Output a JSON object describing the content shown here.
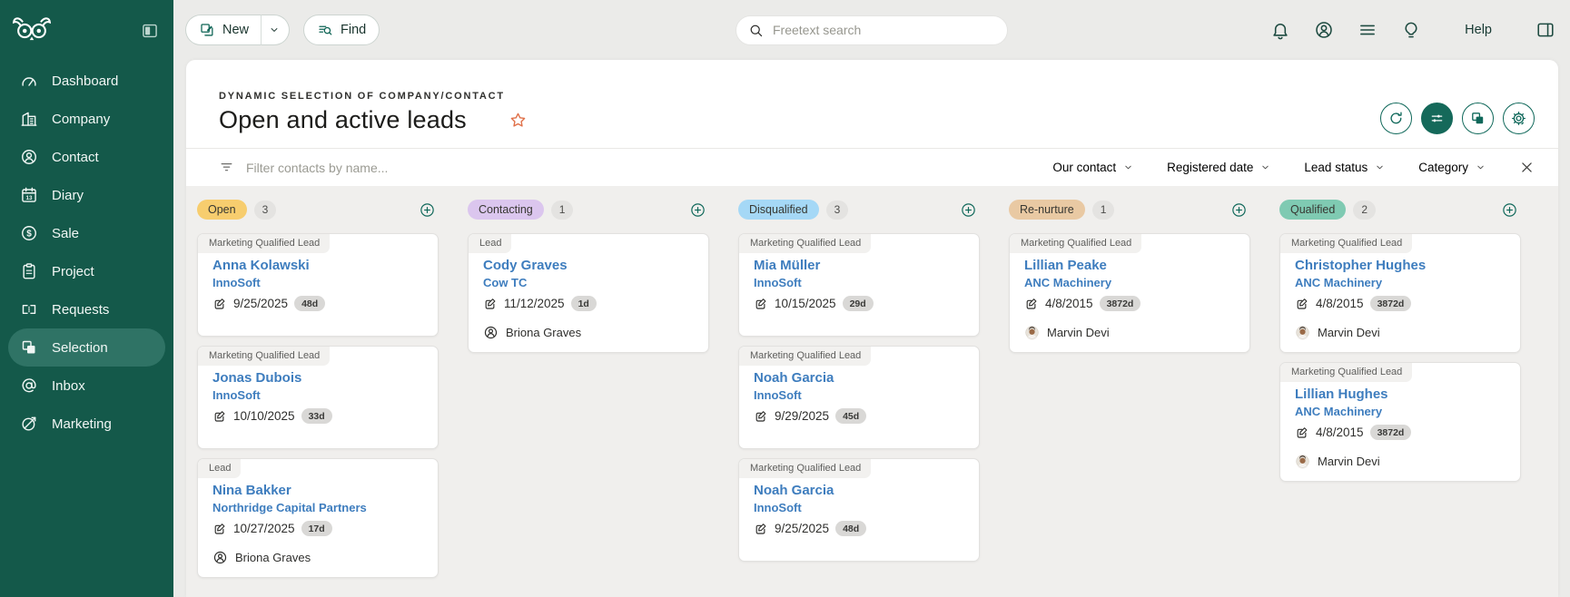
{
  "theme": {
    "sidebar_bg": "#14594a",
    "accent_teal": "#0f685a",
    "link_blue": "#3e7dbe",
    "star_orange": "#e0714a",
    "board_bg": "#f0efed"
  },
  "sidebar": {
    "items": [
      {
        "label": "Dashboard",
        "icon": "dashboard-icon",
        "active": false
      },
      {
        "label": "Company",
        "icon": "company-icon",
        "active": false
      },
      {
        "label": "Contact",
        "icon": "contact-icon",
        "active": false
      },
      {
        "label": "Diary",
        "icon": "diary-icon",
        "active": false
      },
      {
        "label": "Sale",
        "icon": "sale-icon",
        "active": false
      },
      {
        "label": "Project",
        "icon": "project-icon",
        "active": false
      },
      {
        "label": "Requests",
        "icon": "requests-icon",
        "active": false
      },
      {
        "label": "Selection",
        "icon": "selection-icon",
        "active": true
      },
      {
        "label": "Inbox",
        "icon": "inbox-icon",
        "active": false
      },
      {
        "label": "Marketing",
        "icon": "marketing-icon",
        "active": false
      }
    ]
  },
  "topbar": {
    "new_label": "New",
    "find_label": "Find",
    "search_placeholder": "Freetext search",
    "help_label": "Help",
    "icons": [
      {
        "icon": "bell-icon",
        "name": "notifications-button"
      },
      {
        "icon": "account-icon",
        "name": "account-button"
      },
      {
        "icon": "menu-icon",
        "name": "menu-button"
      },
      {
        "icon": "lightbulb-icon",
        "name": "tips-button"
      }
    ]
  },
  "header": {
    "eyebrow": "DYNAMIC SELECTION OF COMPANY/CONTACT",
    "title": "Open and active leads",
    "actions": [
      {
        "icon": "refresh-icon",
        "filled": false,
        "name": "refresh-button"
      },
      {
        "icon": "sliders-icon",
        "filled": true,
        "name": "display-settings-button"
      },
      {
        "icon": "copy-squares-icon",
        "filled": false,
        "name": "selection-mode-button"
      },
      {
        "icon": "gear-icon",
        "filled": false,
        "name": "settings-button"
      }
    ]
  },
  "filter": {
    "placeholder": "Filter contacts by name...",
    "dropdowns": [
      "Our contact",
      "Registered date",
      "Lead status",
      "Category"
    ]
  },
  "board": {
    "columns": [
      {
        "name": "Open",
        "count": "3",
        "color": "#f7cd6e",
        "cards": [
          {
            "tag": "Marketing Qualified Lead",
            "name": "Anna Kolawski",
            "company": "InnoSoft",
            "date": "9/25/2025",
            "age": "48d"
          },
          {
            "tag": "Marketing Qualified Lead",
            "name": "Jonas Dubois",
            "company": "InnoSoft",
            "date": "10/10/2025",
            "age": "33d"
          },
          {
            "tag": "Lead",
            "name": "Nina Bakker",
            "company": "Northridge Capital Partners",
            "date": "10/27/2025",
            "age": "17d",
            "owner": "Briona Graves",
            "owner_type": "icon"
          }
        ]
      },
      {
        "name": "Contacting",
        "count": "1",
        "color": "#dbc6ee",
        "cards": [
          {
            "tag": "Lead",
            "name": "Cody Graves",
            "company": "Cow TC",
            "date": "11/12/2025",
            "age": "1d",
            "owner": "Briona Graves",
            "owner_type": "icon"
          }
        ]
      },
      {
        "name": "Disqualified",
        "count": "3",
        "color": "#a5d8f6",
        "cards": [
          {
            "tag": "Marketing Qualified Lead",
            "name": "Mia Müller",
            "company": "InnoSoft",
            "date": "10/15/2025",
            "age": "29d"
          },
          {
            "tag": "Marketing Qualified Lead",
            "name": "Noah Garcia",
            "company": "InnoSoft",
            "date": "9/29/2025",
            "age": "45d"
          },
          {
            "tag": "Marketing Qualified Lead",
            "name": "Noah Garcia",
            "company": "InnoSoft",
            "date": "9/25/2025",
            "age": "48d"
          }
        ]
      },
      {
        "name": "Re-nurture",
        "count": "1",
        "color": "#e9c9a3",
        "cards": [
          {
            "tag": "Marketing Qualified Lead",
            "name": "Lillian Peake",
            "company": "ANC Machinery",
            "date": "4/8/2015",
            "age": "3872d",
            "owner": "Marvin Devi",
            "owner_type": "avatar"
          }
        ]
      },
      {
        "name": "Qualified",
        "count": "2",
        "color": "#7fcab2",
        "cards": [
          {
            "tag": "Marketing Qualified Lead",
            "name": "Christopher Hughes",
            "company": "ANC Machinery",
            "date": "4/8/2015",
            "age": "3872d",
            "owner": "Marvin Devi",
            "owner_type": "avatar"
          },
          {
            "tag": "Marketing Qualified Lead",
            "name": "Lillian Hughes",
            "company": "ANC Machinery",
            "date": "4/8/2015",
            "age": "3872d",
            "owner": "Marvin Devi",
            "owner_type": "avatar"
          }
        ]
      }
    ]
  }
}
